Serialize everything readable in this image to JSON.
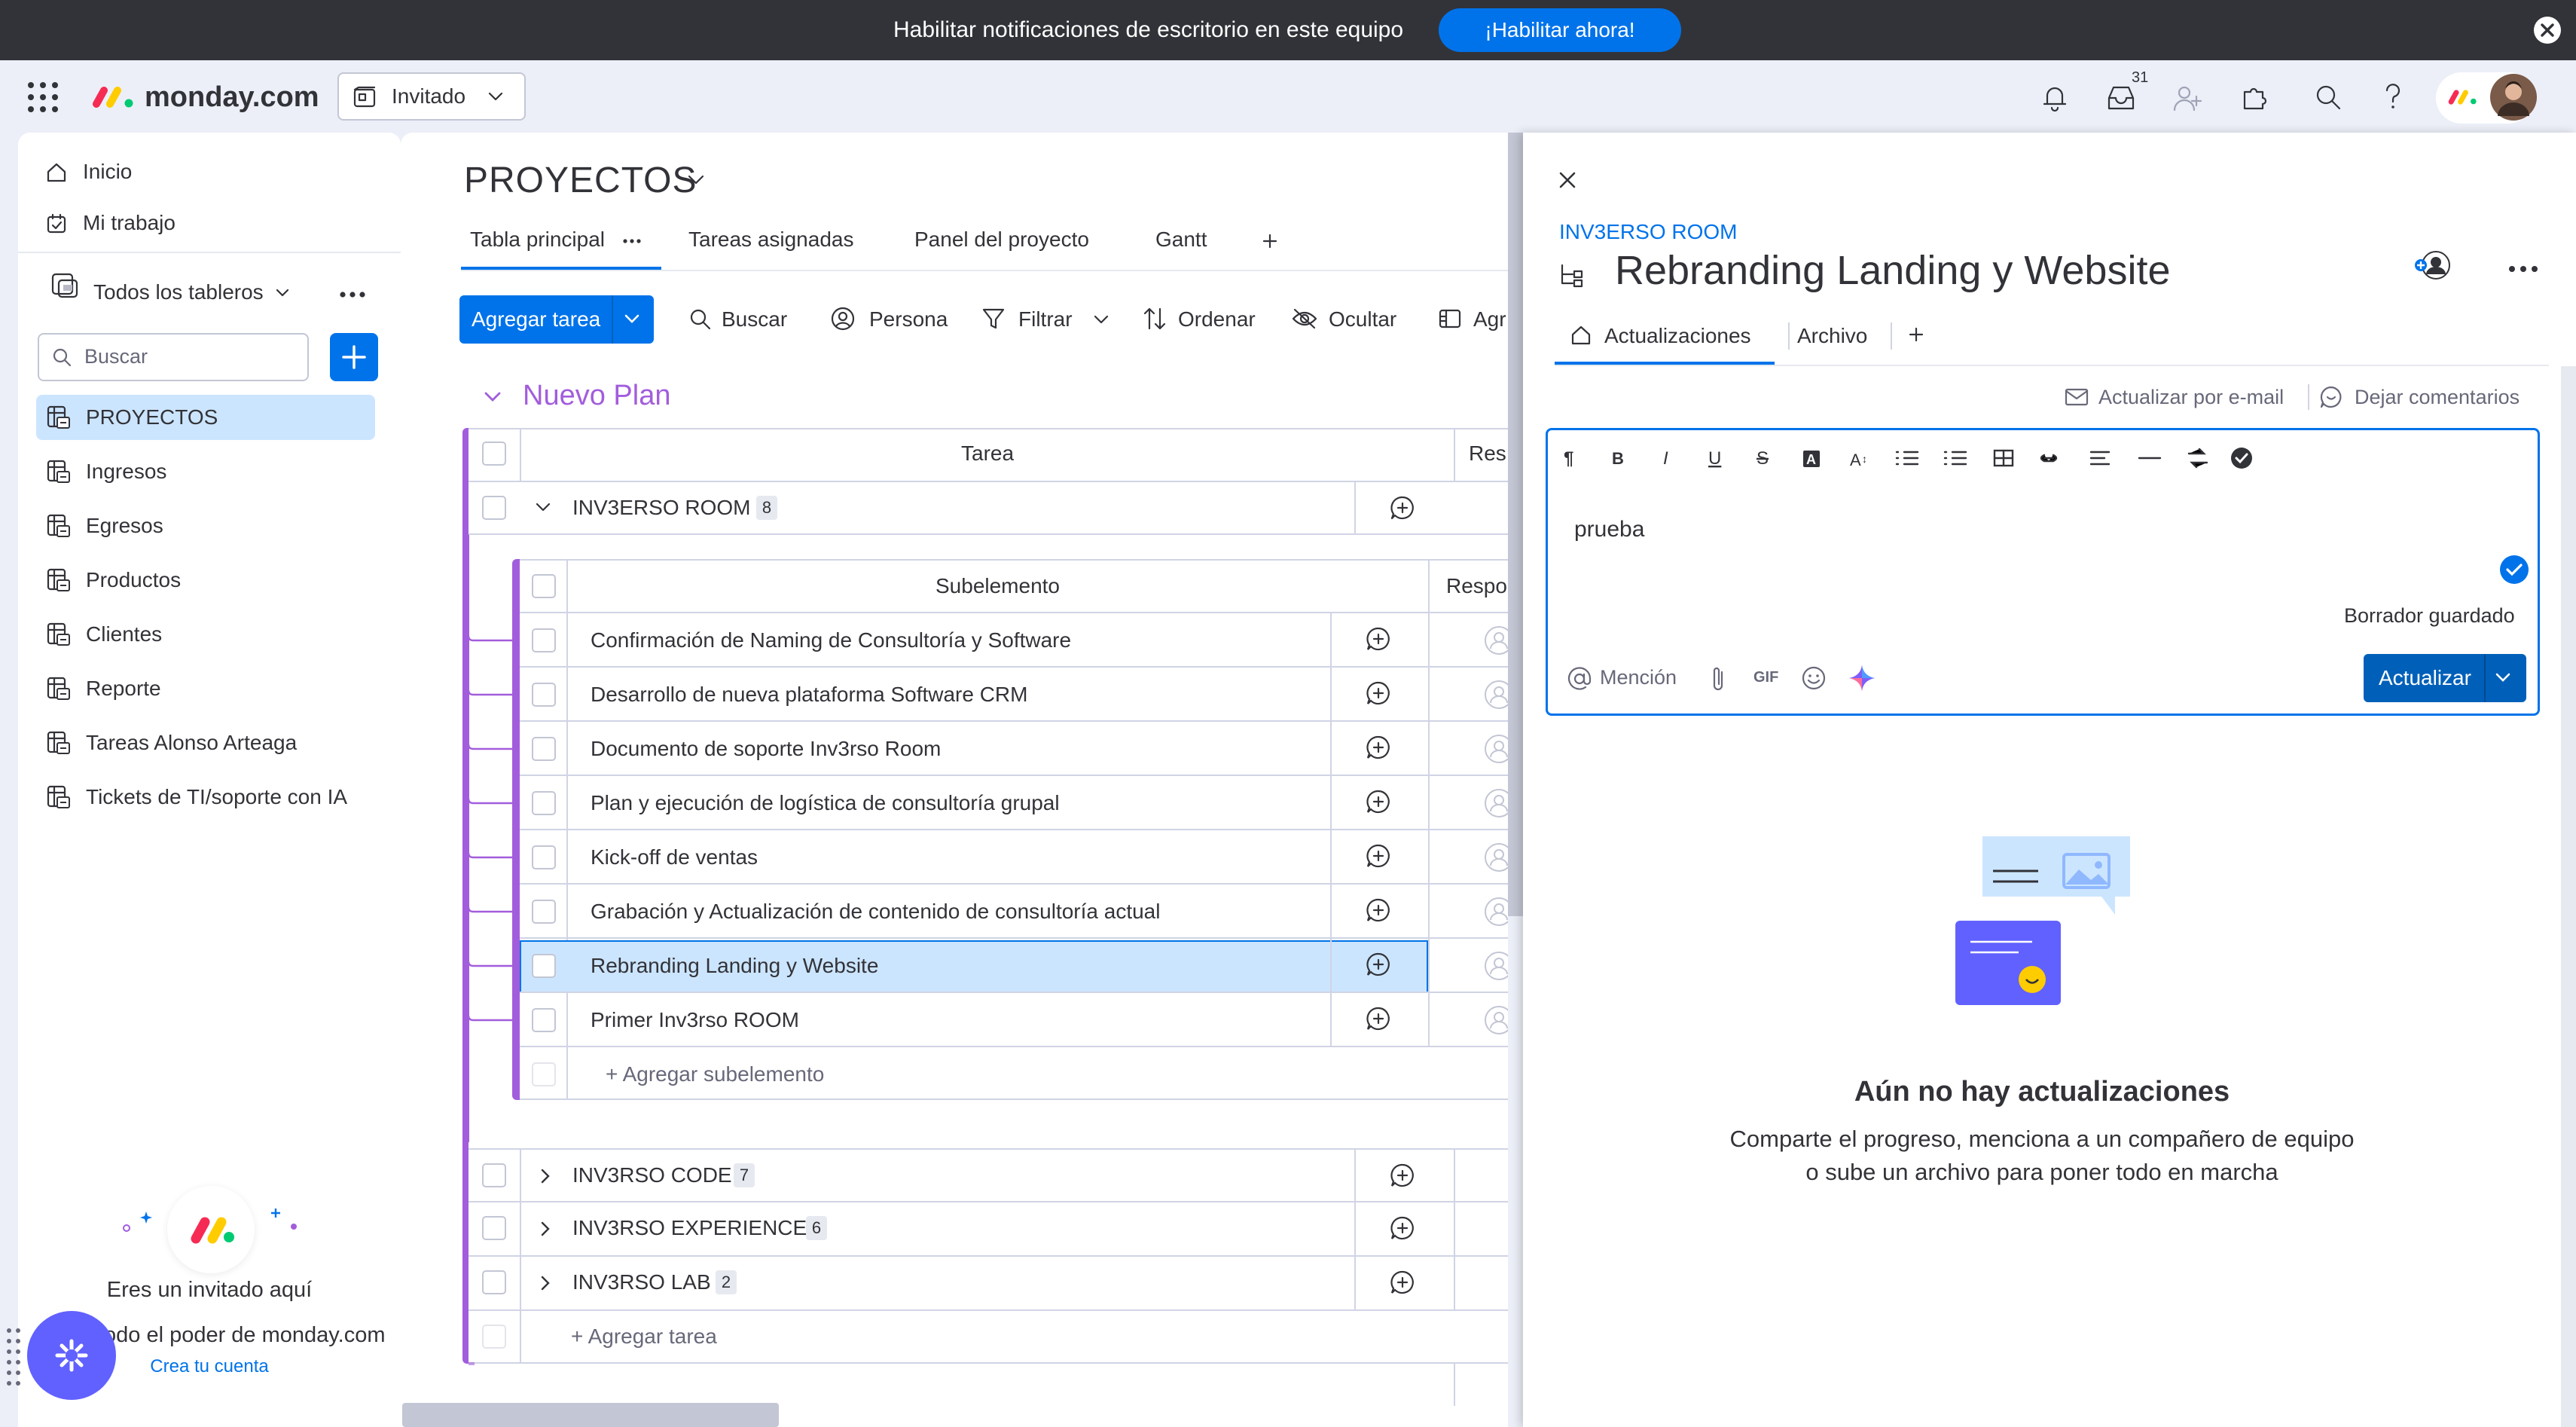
{
  "notification_bar": {
    "text": "Habilitar notificaciones de escritorio en este equipo",
    "button_label": "¡Habilitar ahora!"
  },
  "header": {
    "logo_text": "monday.com",
    "workspace_selector": "Invitado",
    "inbox_count": "31"
  },
  "sidebar": {
    "home": "Inicio",
    "my_work": "Mi trabajo",
    "boards_selector": "Todos los tableros",
    "search_placeholder": "Buscar",
    "boards": [
      {
        "label": "PROYECTOS",
        "active": true
      },
      {
        "label": "Ingresos"
      },
      {
        "label": "Egresos"
      },
      {
        "label": "Productos"
      },
      {
        "label": "Clientes"
      },
      {
        "label": "Reporte"
      },
      {
        "label": "Tareas Alonso Arteaga"
      },
      {
        "label": "Tickets de TI/soporte con IA"
      }
    ],
    "guest_title": "Eres un invitado aquí",
    "guest_desc": "odo el poder de monday.com",
    "guest_link": "Crea tu cuenta"
  },
  "board": {
    "title": "PROYECTOS",
    "tabs": [
      "Tabla principal",
      "Tareas asignadas",
      "Panel del proyecto",
      "Gantt"
    ],
    "add_task": "Agregar tarea",
    "toolbar": {
      "search": "Buscar",
      "person": "Persona",
      "filter": "Filtrar",
      "sort": "Ordenar",
      "hide": "Ocultar",
      "group": "Agr"
    },
    "group_title": "Nuevo Plan",
    "columns": {
      "task": "Tarea",
      "owner": "Res",
      "subitem": "Subelemento",
      "sub_owner": "Respo"
    },
    "items": [
      {
        "name": "INV3ERSO ROOM",
        "count": "8",
        "expanded": true
      },
      {
        "name": "INV3RSO CODE",
        "count": "7"
      },
      {
        "name": "INV3RSO EXPERIENCE",
        "count": "6"
      },
      {
        "name": "INV3RSO LAB",
        "count": "2"
      }
    ],
    "subitems": [
      "Confirmación de Naming de Consultoría y Software",
      "Desarrollo de nueva plataforma Software CRM",
      "Documento de soporte Inv3rso Room",
      "Plan y ejecución de logística de consultoría grupal",
      "Kick-off de ventas",
      "Grabación y Actualización de contenido de consultoría actual",
      "Rebranding Landing y Website",
      "Primer Inv3rso ROOM"
    ],
    "add_subitem": "+ Agregar subelemento",
    "add_item": "+ Agregar tarea"
  },
  "panel": {
    "group_label": "INV3ERSO ROOM",
    "title": "Rebranding Landing y Website",
    "tabs": [
      "Actualizaciones",
      "Archivo"
    ],
    "update_by_email": "Actualizar por e-mail",
    "leave_feedback": "Dejar comentarios",
    "editor_text": "prueba",
    "draft_saved": "Borrador guardado",
    "mention": "Mención",
    "gif": "GIF",
    "submit": "Actualizar",
    "empty_title": "Aún no hay actualizaciones",
    "empty_desc_line1": "Comparte el progreso, menciona a un compañero de equipo",
    "empty_desc_line2": "o sube un archivo para poner todo en marcha"
  },
  "colors": {
    "primary": "#0073ea",
    "group_purple": "#a25ddc",
    "selected_row": "#cce5ff",
    "notification_bg": "#323338"
  }
}
